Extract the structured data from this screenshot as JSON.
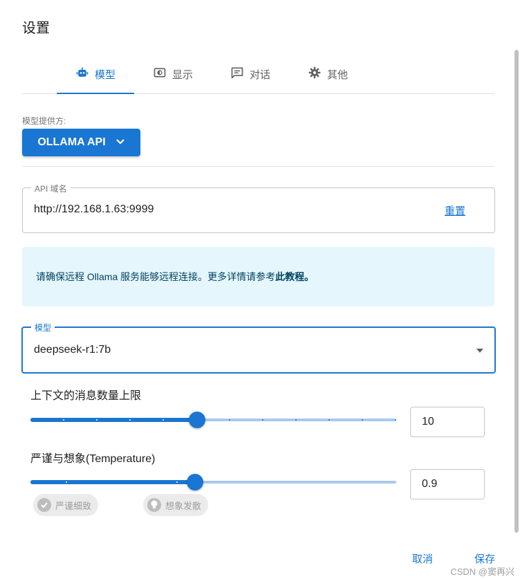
{
  "dialog": {
    "title": "设置"
  },
  "tabs": [
    {
      "label": "模型",
      "icon": "robot-icon",
      "active": true
    },
    {
      "label": "显示",
      "icon": "display-icon",
      "active": false
    },
    {
      "label": "对话",
      "icon": "chat-icon",
      "active": false
    },
    {
      "label": "其他",
      "icon": "gear-icon",
      "active": false
    }
  ],
  "provider": {
    "label": "模型提供方:",
    "value": "OLLAMA API"
  },
  "api_host": {
    "label": "API 域名",
    "value": "http://192.168.1.63:9999",
    "reset_label": "重置"
  },
  "info": {
    "text": "请确保远程 Ollama 服务能够远程连接。更多详情请参考",
    "link": "此教程。"
  },
  "model": {
    "label": "模型",
    "value": "deepseek-r1:7b"
  },
  "context_limit": {
    "label": "上下文的消息数量上限",
    "value": "10",
    "fraction": 0.455
  },
  "temperature": {
    "label": "严谨与想象(Temperature)",
    "value": "0.9",
    "fraction": 0.45,
    "chip_left": "严谨细致",
    "chip_right": "想象发散"
  },
  "actions": {
    "cancel": "取消",
    "save": "保存"
  },
  "watermark": "CSDN @窦再兴",
  "colors": {
    "accent": "#1976d2",
    "info_bg": "#e5f6fd",
    "rail": "#a7caed"
  }
}
